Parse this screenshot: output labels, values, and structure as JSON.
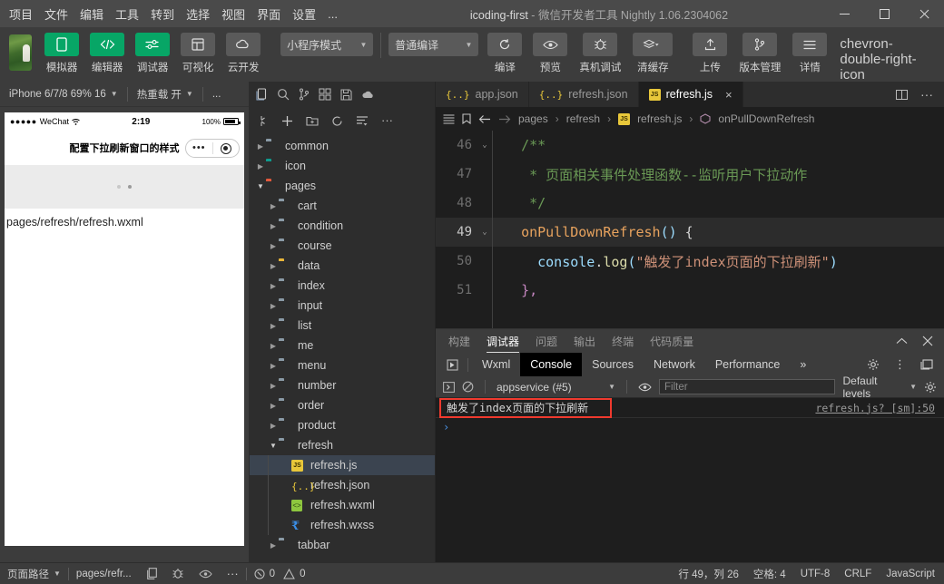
{
  "titlebar": {
    "menus": [
      "项目",
      "文件",
      "编辑",
      "工具",
      "转到",
      "选择",
      "视图",
      "界面",
      "设置",
      "..."
    ],
    "project": "icoding-first",
    "dash": "-",
    "app_title": "微信开发者工具 Nightly 1.06.2304062",
    "minimize": "minimize-icon",
    "maximize": "maximize-icon",
    "close": "close-icon"
  },
  "toolbar": {
    "buttons": [
      {
        "label": "模拟器",
        "icon": "phone-icon",
        "style": "green"
      },
      {
        "label": "编辑器",
        "icon": "code-icon",
        "style": "green"
      },
      {
        "label": "调试器",
        "icon": "sliders-icon",
        "style": "green"
      },
      {
        "label": "可视化",
        "icon": "layout-icon",
        "style": "grey"
      },
      {
        "label": "云开发",
        "icon": "cloud-icon",
        "style": "grey"
      }
    ],
    "mode_select": "小程序模式",
    "compile_select": "普通编译",
    "actions": [
      {
        "label": "编译",
        "icon": "refresh-icon"
      },
      {
        "label": "预览",
        "icon": "eye-icon"
      },
      {
        "label": "真机调试",
        "icon": "bug-icon"
      },
      {
        "label": "清缓存",
        "icon": "layers-icon"
      },
      {
        "label": "上传",
        "icon": "upload-icon"
      },
      {
        "label": "版本管理",
        "icon": "branch-icon"
      },
      {
        "label": "详情",
        "icon": "menu-icon"
      }
    ],
    "overflow": "chevron-double-right-icon"
  },
  "simulator": {
    "device": "iPhone 6/7/8 69% 16",
    "hotreload": "热重载 开",
    "more": "...",
    "phone": {
      "carrier": "WeChat",
      "signal_dots": "●●●●●",
      "time": "2:19",
      "battery_pct": "100%",
      "nav_title": "配置下拉刷新窗口的样式",
      "capsule_more": "•••",
      "page_text": "pages/refresh/refresh.wxml"
    }
  },
  "explorer": {
    "toolbar_icons": [
      "files-icon",
      "search-icon",
      "branch-icon",
      "extensions-icon",
      "save-icon",
      "cloud-icon"
    ],
    "action_icons": [
      "new-file-icon",
      "add-icon",
      "new-folder-icon",
      "refresh-icon",
      "collapse-icon",
      "more-icon"
    ],
    "tree": [
      {
        "label": "common",
        "type": "folder",
        "depth": 0,
        "arrow": "collapsed",
        "color": "grey"
      },
      {
        "label": "icon",
        "type": "folder",
        "depth": 0,
        "arrow": "collapsed",
        "color": "teal"
      },
      {
        "label": "pages",
        "type": "folder",
        "depth": 0,
        "arrow": "expanded",
        "color": "red"
      },
      {
        "label": "cart",
        "type": "folder",
        "depth": 1,
        "arrow": "collapsed",
        "color": "grey"
      },
      {
        "label": "condition",
        "type": "folder",
        "depth": 1,
        "arrow": "collapsed",
        "color": "grey"
      },
      {
        "label": "course",
        "type": "folder",
        "depth": 1,
        "arrow": "collapsed",
        "color": "grey"
      },
      {
        "label": "data",
        "type": "folder",
        "depth": 1,
        "arrow": "collapsed",
        "color": "yellow"
      },
      {
        "label": "index",
        "type": "folder",
        "depth": 1,
        "arrow": "collapsed",
        "color": "grey"
      },
      {
        "label": "input",
        "type": "folder",
        "depth": 1,
        "arrow": "collapsed",
        "color": "grey"
      },
      {
        "label": "list",
        "type": "folder",
        "depth": 1,
        "arrow": "collapsed",
        "color": "grey"
      },
      {
        "label": "me",
        "type": "folder",
        "depth": 1,
        "arrow": "collapsed",
        "color": "grey"
      },
      {
        "label": "menu",
        "type": "folder",
        "depth": 1,
        "arrow": "collapsed",
        "color": "grey"
      },
      {
        "label": "number",
        "type": "folder",
        "depth": 1,
        "arrow": "collapsed",
        "color": "grey"
      },
      {
        "label": "order",
        "type": "folder",
        "depth": 1,
        "arrow": "collapsed",
        "color": "grey"
      },
      {
        "label": "product",
        "type": "folder",
        "depth": 1,
        "arrow": "collapsed",
        "color": "grey"
      },
      {
        "label": "refresh",
        "type": "folder",
        "depth": 1,
        "arrow": "expanded",
        "color": "grey"
      },
      {
        "label": "refresh.js",
        "type": "js",
        "depth": 2,
        "selected": true
      },
      {
        "label": "refresh.json",
        "type": "json",
        "depth": 2
      },
      {
        "label": "refresh.wxml",
        "type": "wxml",
        "depth": 2
      },
      {
        "label": "refresh.wxss",
        "type": "wxss",
        "depth": 2
      },
      {
        "label": "tabbar",
        "type": "folder",
        "depth": 1,
        "arrow": "collapsed",
        "color": "grey"
      }
    ]
  },
  "editor": {
    "tabs": [
      {
        "label": "app.json",
        "type": "json",
        "active": false
      },
      {
        "label": "refresh.json",
        "type": "json",
        "active": false
      },
      {
        "label": "refresh.js",
        "type": "js",
        "active": true,
        "close": "×"
      }
    ],
    "right_icons": [
      "split-editor-icon",
      "more-icon"
    ],
    "breadcrumb": {
      "icons": [
        "outline-icon",
        "bookmark-icon",
        "back-arrow-icon",
        "forward-arrow-icon"
      ],
      "parts": [
        "pages",
        "refresh",
        "refresh.js",
        "onPullDownRefresh"
      ],
      "separator": "›"
    },
    "lines": [
      {
        "num": "46",
        "fold": "v",
        "segments": [
          {
            "t": "  ",
            "c": "pn"
          },
          {
            "t": "/**",
            "c": "cm"
          }
        ]
      },
      {
        "num": "47",
        "fold": "",
        "segments": [
          {
            "t": "   ",
            "c": "pn"
          },
          {
            "t": "* 页面相关事件处理函数--监听用户下拉动作",
            "c": "cm"
          }
        ]
      },
      {
        "num": "48",
        "fold": "",
        "segments": [
          {
            "t": "   ",
            "c": "pn"
          },
          {
            "t": "*/",
            "c": "cm"
          }
        ]
      },
      {
        "num": "49",
        "fold": "v",
        "highlight": true,
        "segments": [
          {
            "t": "  ",
            "c": "pn"
          },
          {
            "t": "onPullDownRefresh",
            "c": "fn"
          },
          {
            "t": "()",
            "c": "id"
          },
          {
            "t": " {",
            "c": "pn"
          }
        ]
      },
      {
        "num": "50",
        "fold": "",
        "segments": [
          {
            "t": "    ",
            "c": "pn"
          },
          {
            "t": "console",
            "c": "id"
          },
          {
            "t": ".",
            "c": "pn"
          },
          {
            "t": "log",
            "c": "kw"
          },
          {
            "t": "(",
            "c": "id"
          },
          {
            "t": "\"触发了index页面的下拉刷新\"",
            "c": "str"
          },
          {
            "t": ")",
            "c": "id"
          }
        ]
      },
      {
        "num": "51",
        "fold": "",
        "segments": [
          {
            "t": "  ",
            "c": "pn"
          },
          {
            "t": "},",
            "c": "pp"
          }
        ]
      }
    ]
  },
  "debugger": {
    "panel_tabs": [
      "构建",
      "调试器",
      "问题",
      "输出",
      "终端",
      "代码质量"
    ],
    "active_panel_tab": "调试器",
    "collapse_icon": "chevron-up-icon",
    "close_icon": "close-icon",
    "devtools_tabs": [
      "Wxml",
      "Console",
      "Sources",
      "Network",
      "Performance"
    ],
    "active_devtools_tab": "Console",
    "overflow": "»",
    "inspect_icon": "inspect-icon",
    "right_icons": [
      "gear-icon",
      "kebab-icon",
      "dock-icon"
    ],
    "console_bar": {
      "sidebar_icon": "console-sidebar-icon",
      "clear_icon": "clear-icon",
      "context": "appservice (#5)",
      "eye_icon": "eye-icon",
      "filter_placeholder": "Filter",
      "levels": "Default levels",
      "settings_icon": "gear-icon"
    },
    "messages": [
      {
        "text": "触发了index页面的下拉刷新",
        "source": "refresh.js? [sm]:50",
        "highlighted": true
      }
    ],
    "prompt": "›"
  },
  "statusbar": {
    "path_label": "页面路径",
    "path_value": "pages/refr...",
    "icons": [
      "copy-icon",
      "bug-icon",
      "eye-icon",
      "more-icon"
    ],
    "errors": "0",
    "warnings": "0",
    "cursor": "行 49，列 26",
    "spaces": "空格: 4",
    "encoding": "UTF-8",
    "eol": "CRLF",
    "language": "JavaScript"
  },
  "colors": {
    "accent_green": "#07a666",
    "alert_red": "#f03a2e",
    "editor_bg": "#1e1e1e",
    "panel_bg": "#3c3c3c"
  }
}
